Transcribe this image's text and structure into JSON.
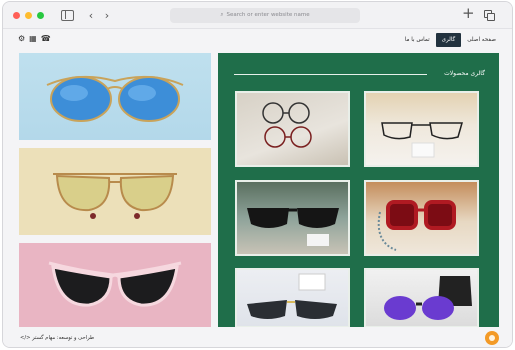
{
  "browser": {
    "url_placeholder": "Search or enter website name",
    "icons": [
      "sidebar-icon",
      "chevron-left-icon",
      "chevron-right-icon",
      "search-icon",
      "plus-icon",
      "tabs-icon"
    ]
  },
  "nav": {
    "menu": [
      {
        "label": "صفحه اصلی",
        "active": false
      },
      {
        "label": "گالری",
        "active": true
      },
      {
        "label": "تماس با ما",
        "active": false
      }
    ],
    "icons": [
      "settings-icon",
      "store-icon",
      "phone-icon"
    ]
  },
  "gallery": {
    "title": "گالری محصولات"
  },
  "footer": {
    "text": "</> طراحی و توسعه: مهام گستر"
  },
  "colors": {
    "gallery_bg": "#1f6e4a",
    "active_menu": "#22323f",
    "logo": "#f39a27"
  }
}
